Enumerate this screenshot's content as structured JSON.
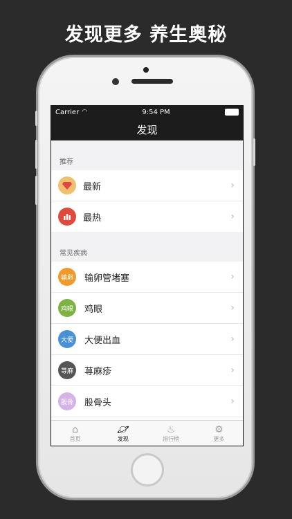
{
  "headline": "发现更多 养生奥秘",
  "status": {
    "carrier": "Carrier",
    "time": "9:54 PM"
  },
  "nav_title": "发现",
  "sections": [
    {
      "title": "推荐",
      "items": [
        {
          "label": "最新",
          "icon": "gem-icon",
          "color": "#f0c070"
        },
        {
          "label": "最热",
          "icon": "chart-icon",
          "color": "#e04a3c"
        }
      ]
    },
    {
      "title": "常见疾病",
      "items": [
        {
          "badge": "输卵",
          "label": "输卵管堵塞",
          "color": "#ef9a2a"
        },
        {
          "badge": "鸡眼",
          "label": "鸡眼",
          "color": "#7cb342"
        },
        {
          "badge": "大便",
          "label": "大便出血",
          "color": "#4a90d9"
        },
        {
          "badge": "荨麻",
          "label": "荨麻疹",
          "color": "#555555"
        },
        {
          "badge": "股骨",
          "label": "股骨头",
          "color": "#d6b3e6"
        }
      ]
    }
  ],
  "tabs": [
    {
      "label": "首页",
      "icon": "home-icon"
    },
    {
      "label": "发现",
      "icon": "planet-icon"
    },
    {
      "label": "排行榜",
      "icon": "flame-icon"
    },
    {
      "label": "更多",
      "icon": "gear-icon"
    }
  ]
}
